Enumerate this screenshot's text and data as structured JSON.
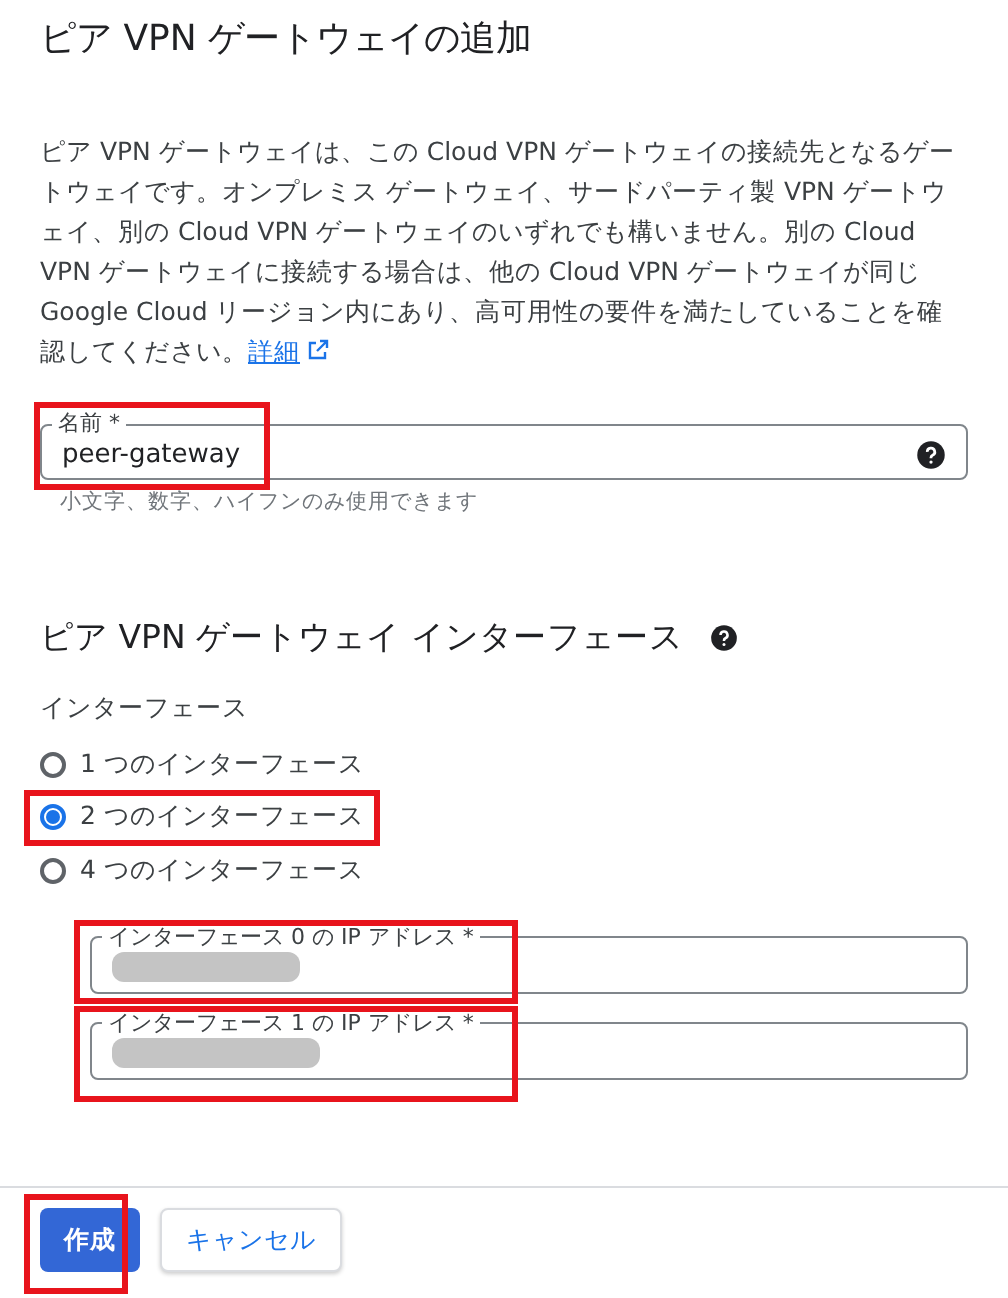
{
  "title": "ピア VPN ゲートウェイの追加",
  "description": "ピア VPN ゲートウェイは、この Cloud VPN ゲートウェイの接続先となるゲートウェイです。オンプレミス ゲートウェイ、サードパーティ製 VPN ゲートウェイ、別の Cloud VPN ゲートウェイのいずれでも構いません。別の Cloud VPN ゲートウェイに接続する場合は、他の Cloud VPN ゲートウェイが同じ Google Cloud リージョン内にあり、高可用性の要件を満たしていることを確認してください。",
  "learn_more": "詳細",
  "name_field": {
    "label": "名前 *",
    "value": "peer-gateway",
    "hint": "小文字、数字、ハイフンのみ使用できます",
    "highlighted": true
  },
  "interfaces_section": {
    "title": "ピア VPN ゲートウェイ インターフェース",
    "group_label": "インターフェース",
    "options": [
      {
        "label": "1 つのインターフェース",
        "selected": false,
        "highlighted": false
      },
      {
        "label": "2 つのインターフェース",
        "selected": true,
        "highlighted": true
      },
      {
        "label": "4 つのインターフェース",
        "selected": false,
        "highlighted": false
      }
    ],
    "ip_fields": [
      {
        "label": "インターフェース 0 の IP アドレス *",
        "redacted": true,
        "highlighted": true
      },
      {
        "label": "インターフェース 1 の IP アドレス *",
        "redacted": true,
        "highlighted": true
      }
    ]
  },
  "buttons": [
    {
      "label": "作成",
      "kind": "primary",
      "highlighted": true
    },
    {
      "label": "キャンセル",
      "kind": "secondary",
      "highlighted": false
    }
  ]
}
